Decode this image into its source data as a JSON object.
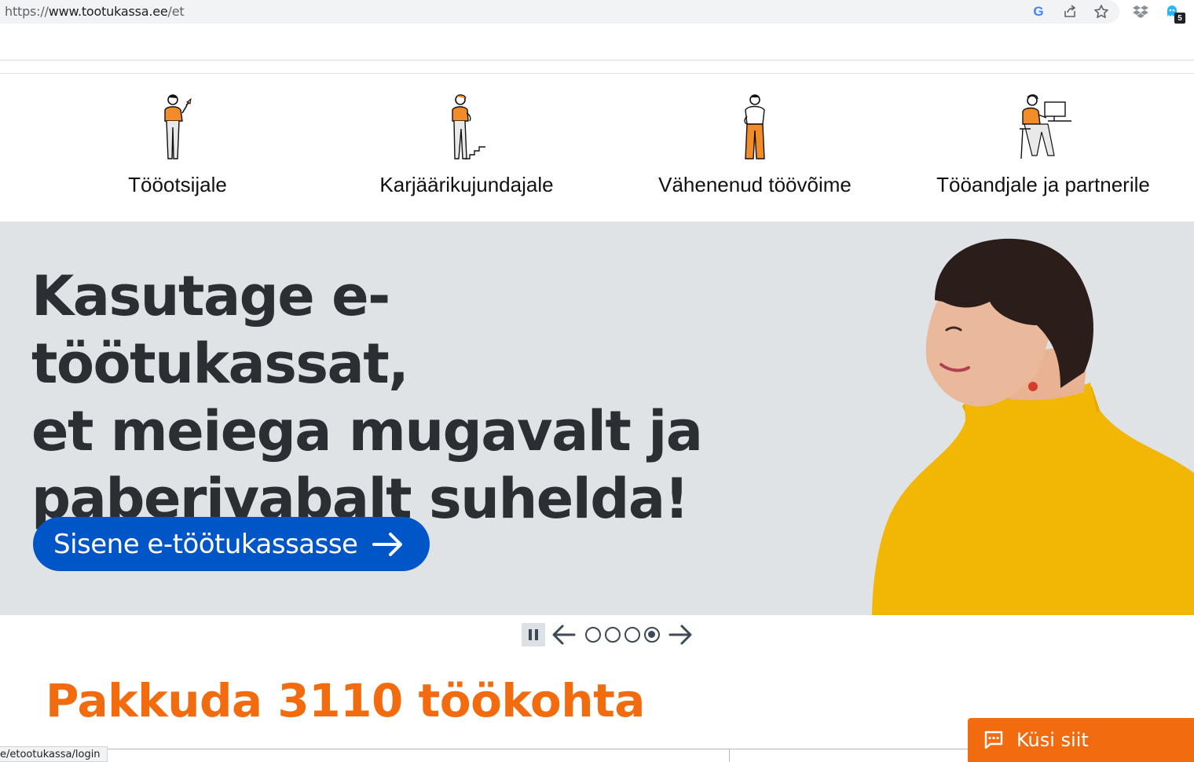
{
  "browser": {
    "url_scheme": "https://",
    "url_host": "www.tootukassa.ee",
    "url_path": "/et",
    "extension_badge": "5",
    "icons": [
      "google-icon",
      "share-icon",
      "star-icon",
      "dropbox-icon",
      "extension-icon"
    ]
  },
  "audience_nav": {
    "items": [
      {
        "label": "Tööotsijale",
        "icon": "jobseeker-illustration-icon"
      },
      {
        "label": "Karjäärikujundajale",
        "icon": "career-illustration-icon"
      },
      {
        "label": "Vähenenud töövõime",
        "icon": "reduced-capacity-illustration-icon"
      },
      {
        "label": "Tööandjale ja partnerile",
        "icon": "employer-illustration-icon"
      }
    ]
  },
  "hero": {
    "heading_line1": "Kasutage e-töötukassat,",
    "heading_line2": "et meiega mugavalt ja",
    "heading_line3": "paberivabalt suhelda!",
    "cta_label": "Sisene e-töötukassasse",
    "background_color": "#e0e3e6",
    "cta_color": "#0056c7"
  },
  "carousel": {
    "slide_count": 4,
    "active_index": 3
  },
  "jobs": {
    "title": "Pakkuda 3110 töökohta",
    "accent_color": "#f26b0f"
  },
  "status_bar": {
    "text": "e/etootukassa/login"
  },
  "chat": {
    "label": "Küsi siit"
  }
}
